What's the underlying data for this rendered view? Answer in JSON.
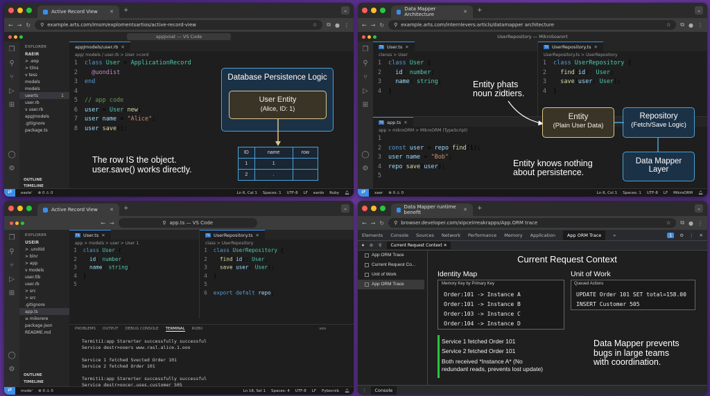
{
  "q1": {
    "tab_title": "Active Record View",
    "url": "example.arts.com/imsm/explomentsartios/active-record-view",
    "vs_title": "appJvoat — VS Code",
    "explorer_header": "EXPLORER",
    "root": "RAEIR",
    "files": [
      ">  .eop",
      ">  tilns",
      "v  tess",
      "    models",
      "    models",
      "    ueerts",
      "    user.rb",
      "v  user.rb",
      "    appJmodels",
      "    .gitignore",
      "    package.ts"
    ],
    "file_badges": [
      "",
      "",
      "",
      "",
      "",
      "1",
      "",
      "",
      "",
      "",
      ""
    ],
    "outline": "OUTLINE",
    "timeline": "TIMELINE",
    "tab_file": "appJmodels/user.rb",
    "crumb": "app/ models / user.rb  >  User >cord",
    "code": [
      {
        "n": "1",
        "t": "class User < ApplicationRecord"
      },
      {
        "n": "2",
        "t": "  @uondist"
      },
      {
        "n": "3",
        "t": "end"
      },
      {
        "n": "4",
        "t": ""
      },
      {
        "n": "5",
        "t": "// app code"
      },
      {
        "n": "6",
        "t": "user = User.new;"
      },
      {
        "n": "7",
        "t": "user.name = \"Alice\";"
      },
      {
        "n": "8",
        "t": "user.save();"
      }
    ],
    "diagram_title": "Database Persistence Logic",
    "entity_line1": "User Entity",
    "entity_line2": "(Alice, ID: 1)",
    "table_headers": [
      "ID",
      "name",
      "row"
    ],
    "table_rows": [
      [
        "1",
        "1",
        ""
      ],
      [
        "2",
        ".",
        ""
      ]
    ],
    "caption1": "The row IS the object.",
    "caption2": "user.save() works directly.",
    "status": {
      "remote": "easte'",
      "counts": "⊗ 0 ⚠ 0",
      "pos": "Ln 6, Cal 1",
      "spaces": "Spaces: 1",
      "enc": "UTF-8",
      "eol": "LF",
      "extra": "eards",
      "lang": "Ruby"
    }
  },
  "q2": {
    "tab_title": "Data Mapper Architecture",
    "url": "example.arts.com/internlevers:articls/datamapper architecture",
    "vs_title": "UserRepository — MikroSoarort",
    "left_tab": "User.ts",
    "left_crumb": "ctenss  >  User",
    "left_code": [
      {
        "n": "1",
        "t": "class User {"
      },
      {
        "n": "2",
        "t": "  id: number;"
      },
      {
        "n": "3",
        "t": "  name: string;"
      },
      {
        "n": "4",
        "t": "}"
      }
    ],
    "right_tab": "UserRepository.ts",
    "right_crumb": "UserRepository.ts  >  UserRepository",
    "right_code": [
      {
        "n": "1",
        "t": "class UserRepository {"
      },
      {
        "n": "2",
        "t": "  find(id): User;"
      },
      {
        "n": "3",
        "t": "  save(user: User);"
      },
      {
        "n": "4",
        "t": "}"
      }
    ],
    "bottom_tab": "app.ts",
    "bottom_crumb": "app  >  mikroORM  >  MikroORM (TypeScript)",
    "bottom_code": [
      {
        "n": "1",
        "t": ""
      },
      {
        "n": "2",
        "t": "const user = repo.find(1);"
      },
      {
        "n": "3",
        "t": "user.name = \"Bob\";"
      },
      {
        "n": "4",
        "t": "repo.save(user);"
      },
      {
        "n": "5",
        "t": ""
      }
    ],
    "annot1": "Entity phats",
    "annot2": "noun zidtiers.",
    "entity_line1": "Entity",
    "entity_line2": "(Plain User Data)",
    "repo_line1": "Repository",
    "repo_line2": "(Fetch/Save Logic)",
    "mapper_line1": "Data Mapper",
    "mapper_line2": "Layer",
    "caption1": "Entity knows nothing",
    "caption2": "about persistence.",
    "status": {
      "remote": "xaer",
      "counts": "⊗ 0 ⚠ 0",
      "pos": "Ln 6, Col 1",
      "spaces": "Spaces: 1",
      "enc": "UTF-8",
      "eol": "LF",
      "lang": "MikroORM"
    }
  },
  "q3": {
    "tab_title": "Active Record View",
    "url": "app.ts — VS Code",
    "explorer_header": "EXPLORER",
    "root": "USEIR",
    "files": [
      ">  .uroitid",
      ">  blnr",
      ">  app",
      "v  models",
      "    user.tlb",
      "    user.rb",
      ">  src",
      ">  src",
      "    .gitignore",
      "    app.ts",
      "≡  mikorere",
      "    package.json",
      "    README.md"
    ],
    "outline": "OUTLINE",
    "timeline": "TIMELINE",
    "left_tab": "User.ts",
    "left_crumb": "app > models > user > User 1",
    "left_code": [
      {
        "n": "1",
        "t": "class User {"
      },
      {
        "n": "2",
        "t": "  id: number;"
      },
      {
        "n": "3",
        "t": "  name: string;"
      },
      {
        "n": "4",
        "t": "}"
      },
      {
        "n": "5",
        "t": ""
      }
    ],
    "right_tab": "UserRepository.ts",
    "right_crumb": "class  >  UserRepository",
    "right_code": [
      {
        "n": "1",
        "t": "class UserRepository {"
      },
      {
        "n": "2",
        "t": "  find(id): User;"
      },
      {
        "n": "3",
        "t": "  save(user: User);"
      },
      {
        "n": "4",
        "t": "}"
      },
      {
        "n": "5",
        "t": ""
      },
      {
        "n": "6",
        "t": "export defalt repo;"
      }
    ],
    "panel_tabs": [
      "PROBLEMS",
      "OUTPUT",
      "DEBUG CONSOLE",
      "TERMINAL",
      "RUBU"
    ],
    "term_shell": "soo",
    "terminal": [
      "Termiti1:app Starerter successfully successful",
      "Service destr>ooers www.rasl.alice.1.ooo",
      "",
      "Service 1 fetched Svected Order 101",
      "Service 2 fetched Order 101",
      "",
      "Termiti1:app Starerter successfully successful",
      "Service destr>oocer.uses.customer 505",
      "▏"
    ],
    "status": {
      "remote": "mode'",
      "counts": "⊗ 0 ⚠ 0",
      "pos": "Ln 18, Sel 1",
      "spaces": "Spaces: 4",
      "enc": "UTF-8",
      "eol": "LF",
      "lang": "Pybecnib"
    }
  },
  "q4": {
    "tab_title": "Data Mapper runtime benefit",
    "url": "browser.developer.com/xipceirreakrapps/App.ORM trace",
    "dt_tabs": [
      "Elements",
      "Console",
      "Sources",
      "Network",
      "Performance",
      "Memory",
      "Application",
      "App ORM Trace",
      "»"
    ],
    "dt_badge": "1",
    "sub_tab": "Current Request Context",
    "side_items": [
      "App ORM Trace",
      "Current Request Co...",
      "Unit of Work",
      "App ORM Trace"
    ],
    "heading": "Current Request Context",
    "identity_title": "Identity Map",
    "identity_sub": "Memory Key by Primary Key",
    "identity_rows": [
      "Order:101 -> Instance A",
      "Order:101 -> Instance B",
      "Order:103 -> Instance C",
      "Order:104 -> Instance D"
    ],
    "uow_title": "Unit of Work",
    "uow_sub": "Queued Actions",
    "uow_rows": [
      "UPDATE Order 101 SET total=158.00",
      "INSERT Customer 505"
    ],
    "log1": "Service 1 fetched Order 101",
    "log2": "Service 2 fetched Order 101",
    "log3a": "Both received *Instance A* (No",
    "log3b": "redundant reads, prevents lost update)",
    "caption1": "Data Mapper prevents",
    "caption2": "bugs in large teams",
    "caption3": "with coordination.",
    "console_label": "Console"
  }
}
